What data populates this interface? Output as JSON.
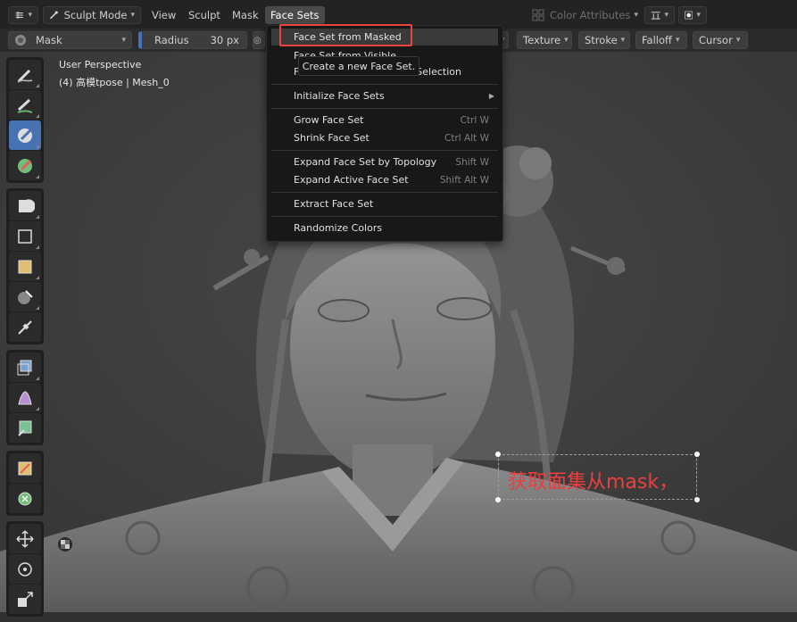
{
  "header": {
    "mode_label": "Sculpt Mode",
    "menus": [
      "View",
      "Sculpt",
      "Mask",
      "Face Sets"
    ],
    "color_attributes_label": "Color Attributes"
  },
  "tool_header": {
    "brush_name": "Mask",
    "radius_label": "Radius",
    "radius_value": "30 px",
    "dropdowns": [
      "Texture",
      "Stroke",
      "Falloff",
      "Cursor"
    ]
  },
  "viewport": {
    "perspective_label": "User Perspective",
    "object_label": "(4) 高模tpose | Mesh_0"
  },
  "face_sets_menu": {
    "items": [
      {
        "label": "Face Set from Masked",
        "shortcut": ""
      },
      {
        "label": "Face Set from Visible",
        "shortcut": ""
      },
      {
        "label": "Face Set from Edit Mode Selection",
        "shortcut": ""
      },
      {
        "label": "Initialize Face Sets",
        "shortcut": ""
      },
      {
        "label": "Grow Face Set",
        "shortcut": "Ctrl W"
      },
      {
        "label": "Shrink Face Set",
        "shortcut": "Ctrl Alt W"
      },
      {
        "label": "Expand Face Set by Topology",
        "shortcut": "Shift W"
      },
      {
        "label": "Expand Active Face Set",
        "shortcut": "Shift Alt W"
      },
      {
        "label": "Extract Face Set",
        "shortcut": ""
      },
      {
        "label": "Randomize Colors",
        "shortcut": ""
      }
    ]
  },
  "tooltip": {
    "text": "Create a new Face Set."
  },
  "annotation": {
    "text": "获取面集从mask，",
    "color": "#e84040"
  },
  "colors": {
    "accent": "#4772b3",
    "highlight_box": "#e8443e"
  }
}
